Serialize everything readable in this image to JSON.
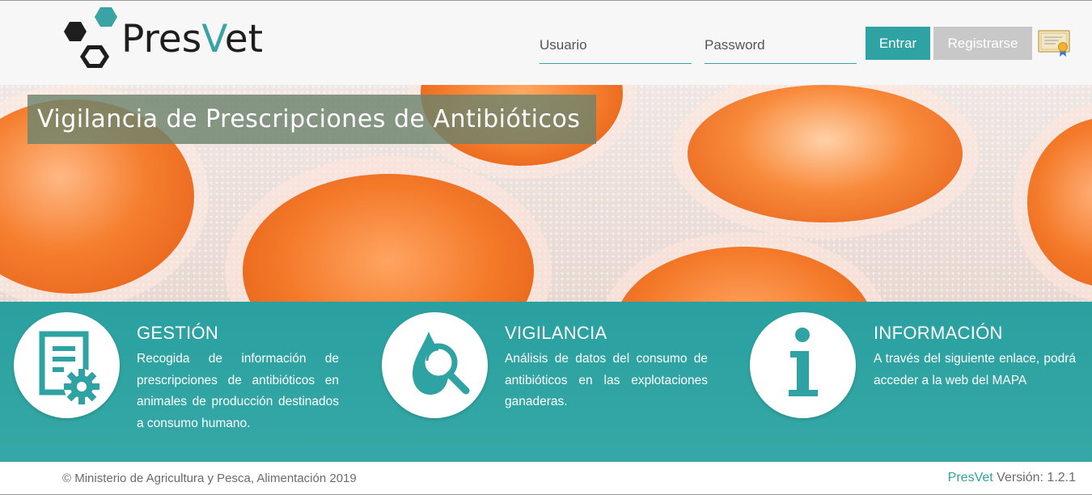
{
  "header": {
    "logo": {
      "prefix": "Pres",
      "accent": "V",
      "suffix": "et"
    },
    "login": {
      "user_placeholder": "Usuario",
      "password_placeholder": "Password",
      "enter_label": "Entrar",
      "register_label": "Registrarse",
      "certificate_icon": "certificate-icon"
    }
  },
  "hero": {
    "title": "Vigilancia de Prescripciones de Antibióticos"
  },
  "features": [
    {
      "icon": "document-gear-icon",
      "title": "GESTIÓN",
      "text": "Recogida de información de prescripciones de antibióticos en animales de producción destinados a consumo humano."
    },
    {
      "icon": "drop-magnifier-icon",
      "title": "VIGILANCIA",
      "text": "Análisis de datos del consumo de antibióticos en las explotaciones ganaderas."
    },
    {
      "icon": "info-icon",
      "title": "INFORMACIÓN",
      "text": "A través del siguiente enlace, podrá acceder a la web del MAPA"
    }
  ],
  "footer": {
    "copyright": "© Ministerio de Agricultura y Pesca, Alimentación 2019",
    "version_brand": "PresVet",
    "version_label": "Versión: 1.2.1"
  },
  "colors": {
    "accent": "#2fa3a3",
    "register_button": "#c8c8c8",
    "band": "#2aa0a0",
    "hero_title_bg": "#6c846c",
    "pill_orange": "#f47a2a"
  }
}
